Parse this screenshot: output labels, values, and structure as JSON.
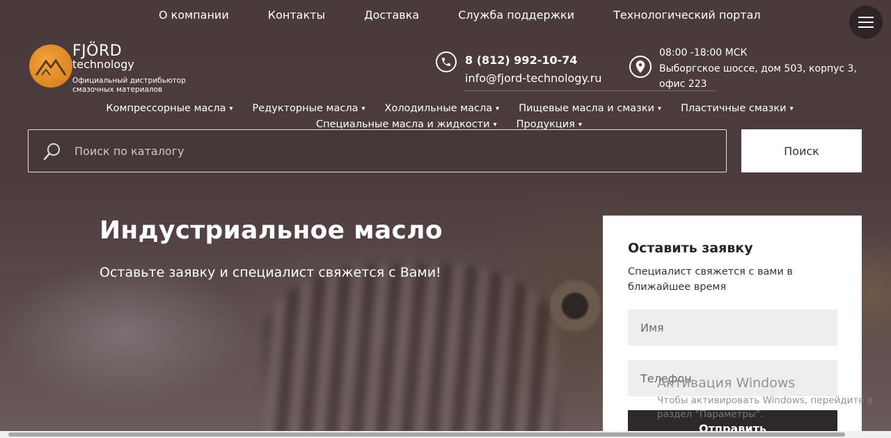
{
  "top_nav": [
    "О компании",
    "Контакты",
    "Доставка",
    "Служба поддержки",
    "Технологический портал"
  ],
  "logo": {
    "name": "FJÖRD",
    "sub": "technology",
    "tagline": "Официальный дистрибьютор смазочных материалов"
  },
  "contacts": {
    "phone": "8 (812) 992-10-74",
    "email": "info@fjord-technology.ru",
    "hours": "08:00 -18:00 МСК",
    "address_line1": "Выборгское шоссе, дом 503, корпус 3,",
    "address_line2": "офис 223"
  },
  "category_menu": {
    "row1": [
      "Компрессорные масла",
      "Редукторные масла",
      "Холодильные масла",
      "Пищевые масла и смазки",
      "Пластичные смазки"
    ],
    "row2": [
      "Специальные масла и жидкости",
      "Продукция"
    ]
  },
  "search": {
    "placeholder": "Поиск по каталогу",
    "button": "Поиск"
  },
  "hero": {
    "title": "Индустриальное масло",
    "subtitle": "Оставьте заявку и специалист свяжется с Вами!"
  },
  "form": {
    "title": "Оставить заявку",
    "description": "Специалист свяжется с вами в ближайшее время",
    "name_placeholder": "Имя",
    "phone_placeholder": "Телефон",
    "submit": "Отправить"
  },
  "watermark": {
    "title": "Активация Windows",
    "text": "Чтобы активировать Windows, перейдите в раздел \"Параметры\"."
  },
  "colors": {
    "header_bg": "#4a3a3c",
    "form_button": "#2f2828",
    "logo_orange": "#e38a22"
  }
}
